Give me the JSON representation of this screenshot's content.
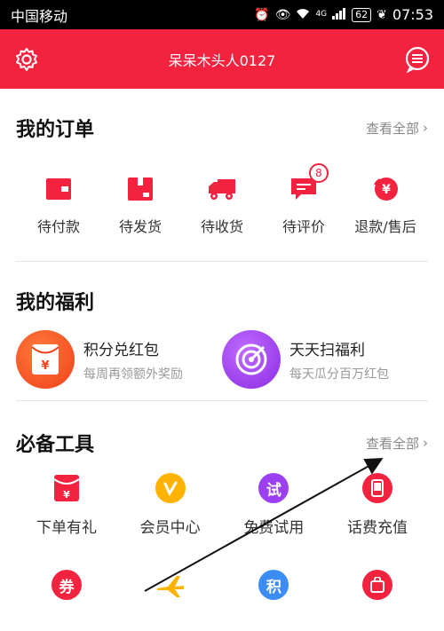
{
  "status_bar": {
    "carrier": "中国移动",
    "network": "4G",
    "battery": "62",
    "time": "07:53"
  },
  "header": {
    "title": "呆呆木头人0127",
    "settings_icon": "gear-icon",
    "message_icon": "message-icon"
  },
  "orders": {
    "title": "我的订单",
    "view_all": "查看全部",
    "items": [
      {
        "label": "待付款",
        "icon": "wallet-icon"
      },
      {
        "label": "待发货",
        "icon": "package-icon"
      },
      {
        "label": "待收货",
        "icon": "truck-icon"
      },
      {
        "label": "待评价",
        "icon": "comment-icon",
        "badge": "8"
      },
      {
        "label": "退款/售后",
        "icon": "refund-icon"
      }
    ]
  },
  "welfare": {
    "title": "我的福利",
    "items": [
      {
        "title": "积分兑红包",
        "subtitle": "每周再领额外奖励",
        "icon": "red-envelope-icon"
      },
      {
        "title": "天天扫福利",
        "subtitle": "每天瓜分百万红包",
        "icon": "radar-icon"
      }
    ]
  },
  "tools": {
    "title": "必备工具",
    "view_all": "查看全部",
    "items": [
      {
        "label": "下单有礼",
        "icon": "gift-envelope-icon"
      },
      {
        "label": "会员中心",
        "icon": "vip-icon"
      },
      {
        "label": "免费试用",
        "icon": "trial-icon",
        "glyph": "试"
      },
      {
        "label": "话费充值",
        "icon": "phone-icon"
      }
    ],
    "items_row2": [
      {
        "icon": "coupon-icon",
        "glyph": "券"
      },
      {
        "icon": "airplane-icon"
      },
      {
        "icon": "points-icon",
        "glyph": "积"
      },
      {
        "icon": "shopping-bag-icon"
      }
    ]
  },
  "colors": {
    "brand_red": "#f3223f",
    "orange": "#ff6a2a",
    "purple": "#9b3ff2",
    "yellow": "#ffb300",
    "blue": "#3b8cf5"
  }
}
